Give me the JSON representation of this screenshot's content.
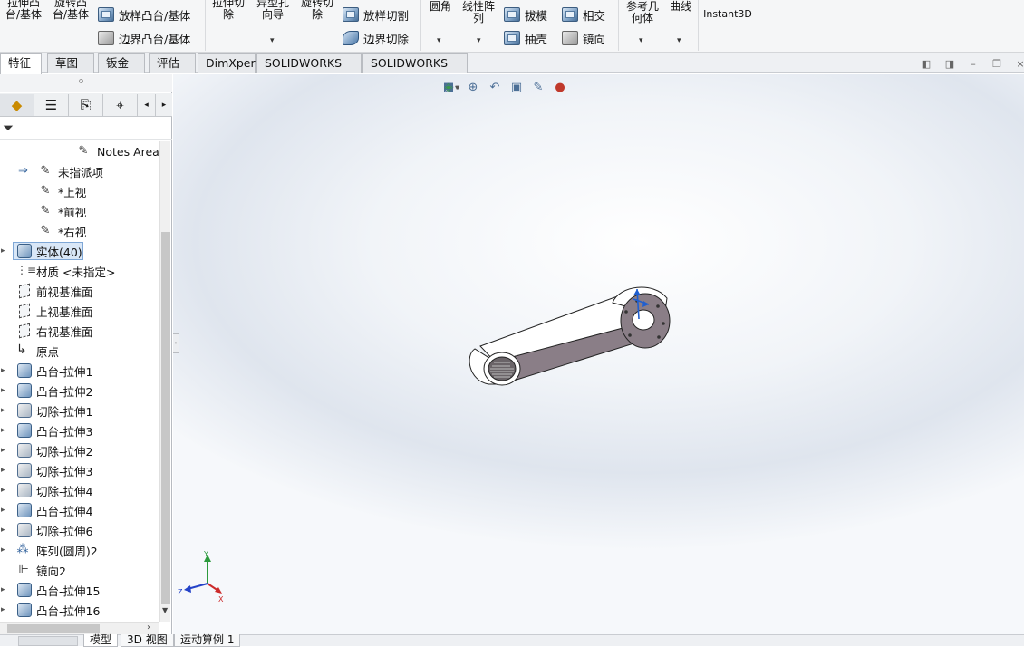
{
  "ribbon": {
    "extrude_boss": "拉伸凸\n台/基体",
    "revolve_boss": "旋转凸\n台/基体",
    "loft_boss": "放样凸台/基体",
    "boundary_boss": "边界凸台/基体",
    "extrude_cut": "拉伸切\n除",
    "hole_wizard": "异型孔\n向导",
    "revolve_cut": "旋转切\n除",
    "loft_cut": "放样切割",
    "boundary_cut": "边界切除",
    "fillet": "圆角",
    "linear_pattern": "线性阵\n列",
    "draft": "拔模",
    "intersect": "相交",
    "shell": "抽壳",
    "mirror": "镜向",
    "ref_geometry": "参考几\n何体",
    "curves": "曲线",
    "instant3d": "Instant3D"
  },
  "tabs": [
    "特征",
    "草图",
    "钣金",
    "评估",
    "DimXpert",
    "SOLIDWORKS 插件",
    "SOLIDWORKS MBD"
  ],
  "active_tab": "特征",
  "tree": {
    "notes_area": "Notes Area",
    "items": [
      {
        "label": "未指派项",
        "icon": "annotation-icon"
      },
      {
        "label": "*上视",
        "icon": "annotation-view-icon"
      },
      {
        "label": "*前视",
        "icon": "annotation-view-icon"
      },
      {
        "label": "*右视",
        "icon": "annotation-view-icon"
      },
      {
        "label": "实体(40)",
        "icon": "solid-bodies-icon"
      },
      {
        "label": "材质 <未指定>",
        "icon": "material-icon"
      },
      {
        "label": "前视基准面",
        "icon": "plane-icon"
      },
      {
        "label": "上视基准面",
        "icon": "plane-icon"
      },
      {
        "label": "右视基准面",
        "icon": "plane-icon"
      },
      {
        "label": "原点",
        "icon": "origin-icon"
      },
      {
        "label": "凸台-拉伸1",
        "icon": "boss-extrude-icon"
      },
      {
        "label": "凸台-拉伸2",
        "icon": "boss-extrude-icon"
      },
      {
        "label": "切除-拉伸1",
        "icon": "cut-extrude-icon"
      },
      {
        "label": "凸台-拉伸3",
        "icon": "boss-extrude-icon"
      },
      {
        "label": "切除-拉伸2",
        "icon": "cut-extrude-icon"
      },
      {
        "label": "切除-拉伸3",
        "icon": "cut-extrude-icon"
      },
      {
        "label": "切除-拉伸4",
        "icon": "cut-extrude-icon"
      },
      {
        "label": "凸台-拉伸4",
        "icon": "boss-extrude-icon"
      },
      {
        "label": "切除-拉伸6",
        "icon": "cut-extrude-icon"
      },
      {
        "label": "阵列(圆周)2",
        "icon": "circular-pattern-icon"
      },
      {
        "label": "镜向2",
        "icon": "mirror-icon"
      },
      {
        "label": "凸台-拉伸15",
        "icon": "boss-extrude-icon"
      },
      {
        "label": "凸台-拉伸16",
        "icon": "boss-extrude-icon"
      }
    ]
  },
  "triad": {
    "x": "X",
    "y": "Y",
    "z": "Z"
  },
  "bottom_tabs": [
    "模型",
    "3D 视图",
    "运动算例 1"
  ],
  "colors": {
    "accent": "#2e5f9a",
    "ribbon_bg": "#f5f6f7",
    "part_face": "#8a7e87",
    "part_body": "#ffffff"
  }
}
